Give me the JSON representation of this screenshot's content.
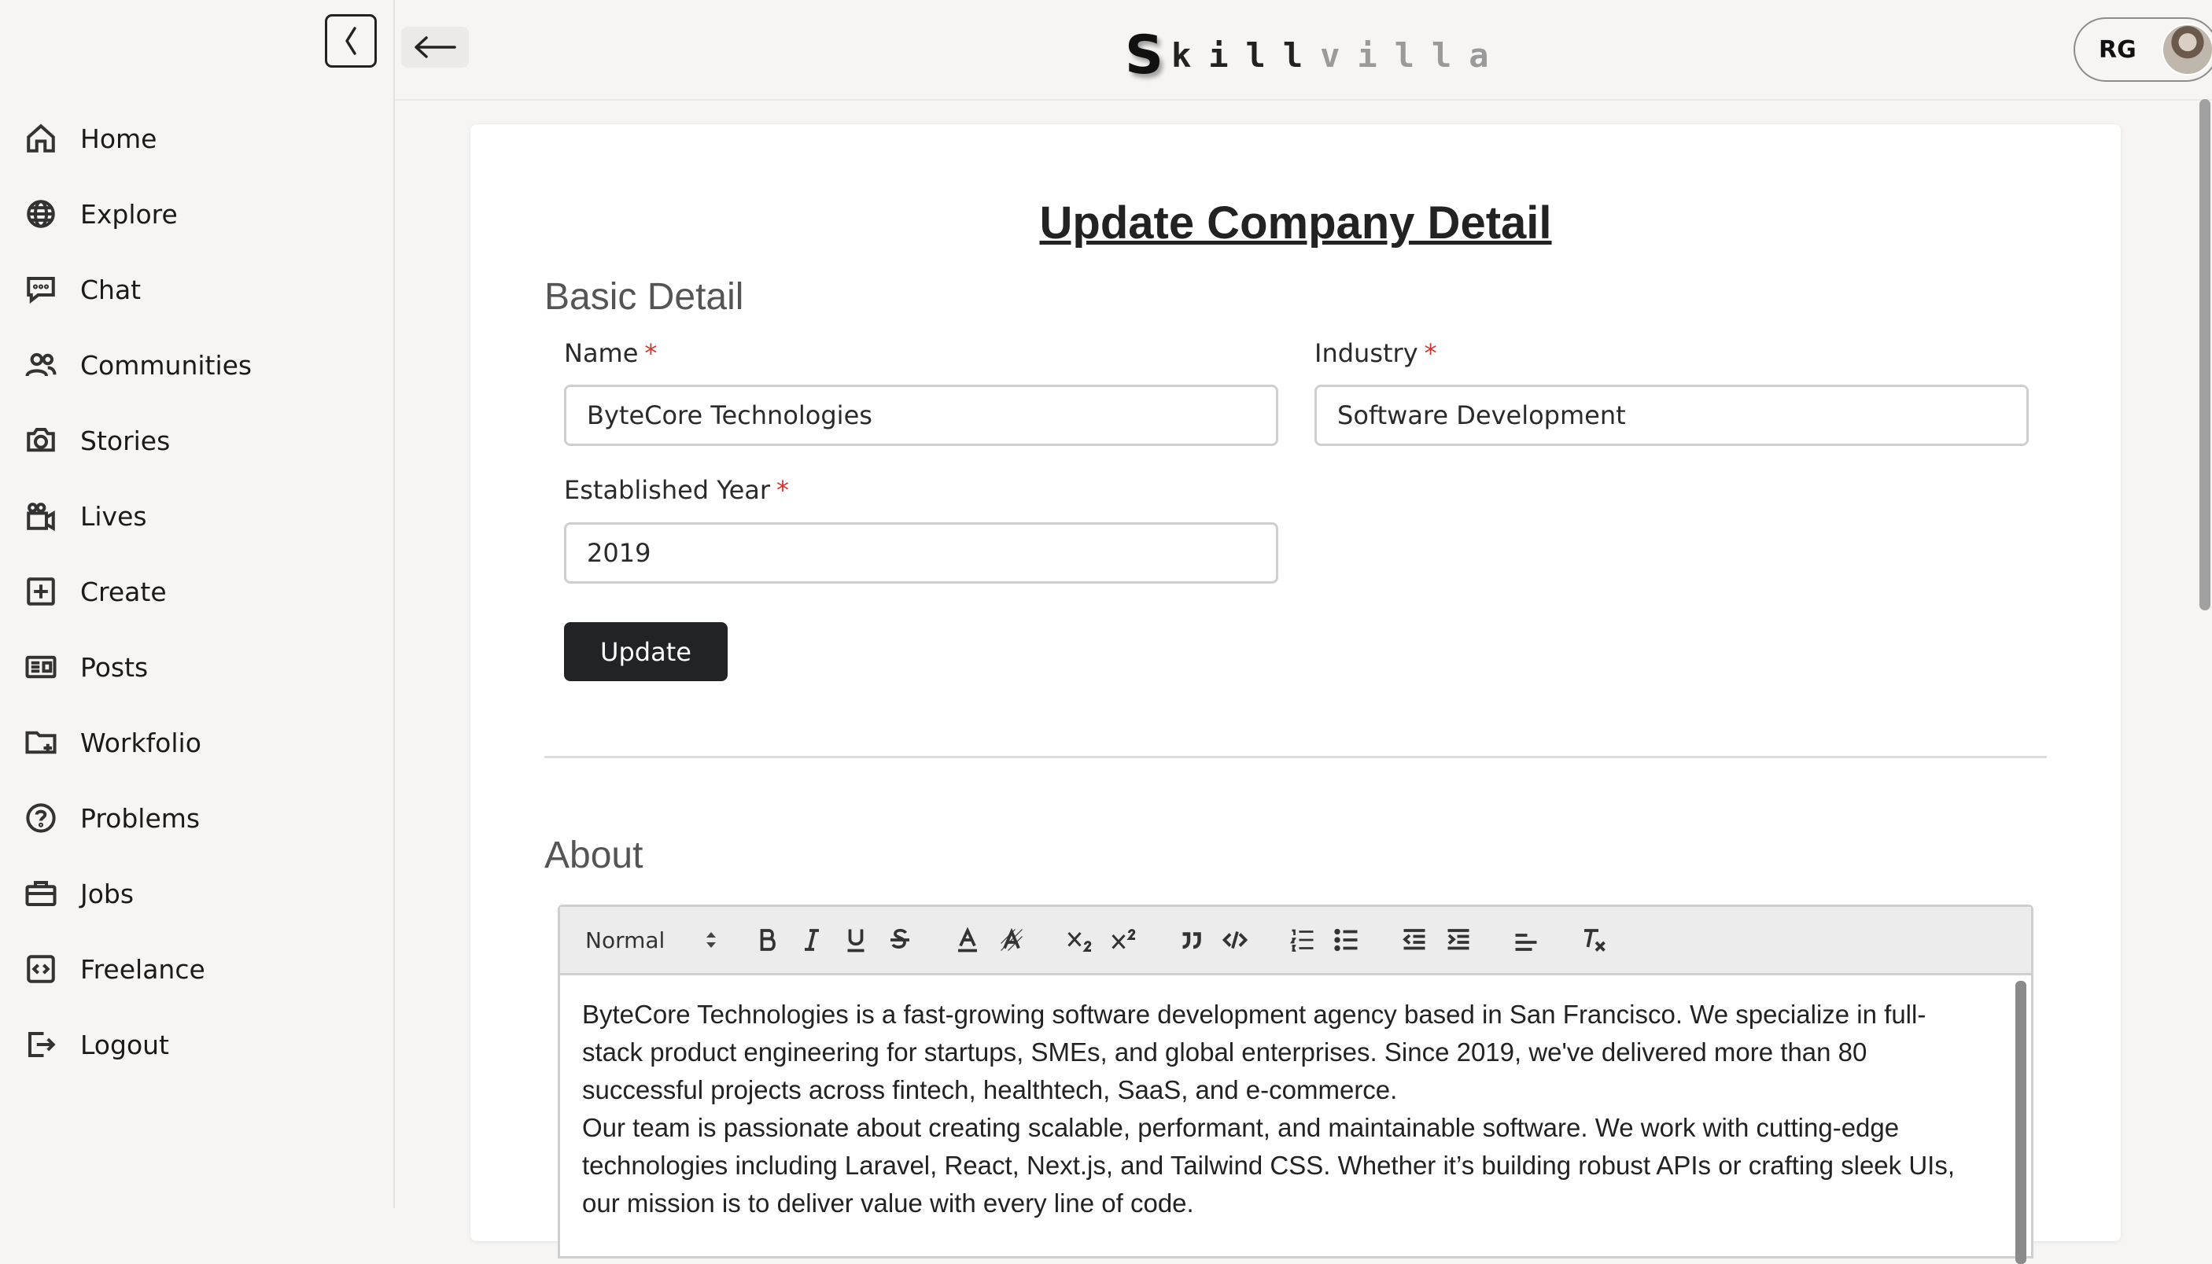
{
  "brand": {
    "logo_s": "S",
    "logo_dark": "kill",
    "logo_light": "villa"
  },
  "sidebar": {
    "items": [
      {
        "label": "Home",
        "icon": "home-icon"
      },
      {
        "label": "Explore",
        "icon": "globe-icon"
      },
      {
        "label": "Chat",
        "icon": "chat-icon"
      },
      {
        "label": "Communities",
        "icon": "users-icon"
      },
      {
        "label": "Stories",
        "icon": "camera-icon"
      },
      {
        "label": "Lives",
        "icon": "video-icon"
      },
      {
        "label": "Create",
        "icon": "plus-square-icon"
      },
      {
        "label": "Posts",
        "icon": "newspaper-icon"
      },
      {
        "label": "Workfolio",
        "icon": "folder-plus-icon"
      },
      {
        "label": "Problems",
        "icon": "question-circle-icon"
      },
      {
        "label": "Jobs",
        "icon": "briefcase-icon"
      },
      {
        "label": "Freelance",
        "icon": "code-square-icon"
      },
      {
        "label": "Logout",
        "icon": "logout-icon"
      }
    ]
  },
  "header": {
    "profile_initials": "RG"
  },
  "form": {
    "title": "Update Company Detail",
    "basic_section": "Basic Detail",
    "name_label": "Name",
    "name_value": "ByteCore Technologies",
    "industry_label": "Industry",
    "industry_value": "Software Development",
    "year_label": "Established Year",
    "year_value": "2019",
    "required_mark": "*",
    "update_label": "Update",
    "about_section": "About"
  },
  "editor": {
    "format_select": "Normal",
    "paragraphs": [
      "ByteCore Technologies is a fast-growing software development agency based in San Francisco. We specialize in full-stack product engineering for startups, SMEs, and global enterprises. Since 2019, we've delivered more than 80 successful projects across fintech, healthtech, SaaS, and e-commerce.",
      "Our team is passionate about creating scalable, performant, and maintainable software. We work with cutting-edge technologies including Laravel, React, Next.js, and Tailwind CSS. Whether it’s building robust APIs or crafting sleek UIs, our mission is to deliver value with every line of code."
    ]
  }
}
